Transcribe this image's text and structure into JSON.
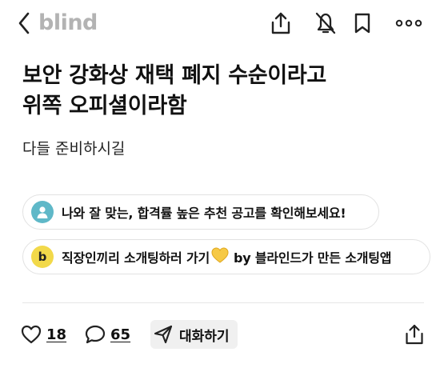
{
  "header": {
    "brand": "blind",
    "back_icon": "chevron-left-icon",
    "actions": [
      "share-icon",
      "bell-off-icon",
      "bookmark-icon",
      "more-dots-icon"
    ]
  },
  "post": {
    "title_line1": "보안 강화상 재택 폐지 수순이라고",
    "title_line2": "위쪽 오피셜이라함",
    "body": "다들 준비하시길"
  },
  "promos": [
    {
      "text": "나와 잘 맞는, 합격률 높은 추천 공고를 확인해보세요!",
      "icon": "person-icon",
      "color": "#5fb8c8"
    },
    {
      "text_before": "직장인끼리 소개팅하러 가기",
      "emoji": "yellow-heart-icon",
      "text_after": "by 블라인드가 만든 소개팅앱",
      "icon": "b-badge-icon",
      "color": "#f2d94a"
    }
  ],
  "actions": {
    "likes": "18",
    "comments": "65",
    "chat_label": "대화하기"
  }
}
